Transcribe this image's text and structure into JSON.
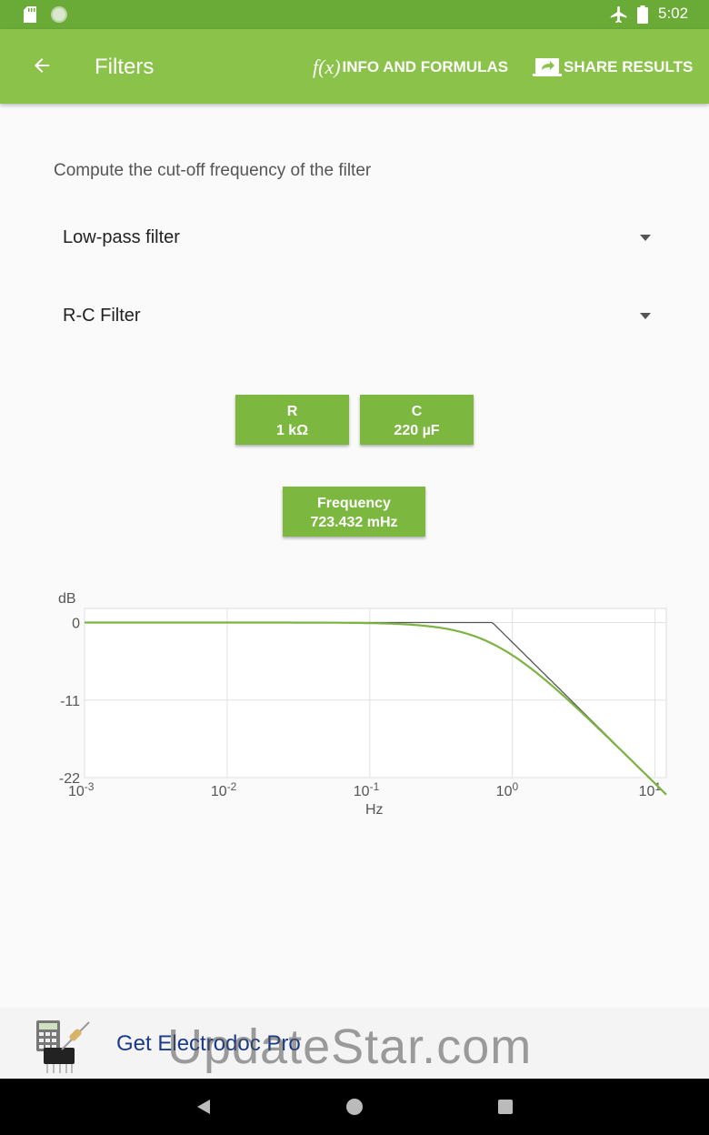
{
  "status_bar": {
    "time": "5:02"
  },
  "app_bar": {
    "title": "Filters",
    "info_icon": "f(x)",
    "info_label": "INFO AND FORMULAS",
    "share_label": "SHARE RESULTS"
  },
  "main": {
    "subtitle": "Compute the cut-off frequency of the filter",
    "filter_select": {
      "value": "Low-pass filter"
    },
    "type_select": {
      "value": "R-C Filter"
    },
    "params": {
      "r": {
        "label": "R",
        "value": "1 kΩ"
      },
      "c": {
        "label": "C",
        "value": "220 µF"
      },
      "frequency": {
        "label": "Frequency",
        "value": "723.432 mHz"
      }
    }
  },
  "chart_data": {
    "type": "line",
    "ylabel": "dB",
    "xlabel": "Hz",
    "x_scale": "log",
    "xlim": [
      0.001,
      12
    ],
    "ylim": [
      -22,
      2
    ],
    "y_ticks": [
      0,
      -11,
      -22
    ],
    "x_ticks": [
      "10-3",
      "10-2",
      "10-1",
      "100",
      "101"
    ],
    "x_tick_values": [
      0.001,
      0.01,
      0.1,
      1,
      10
    ],
    "cutoff_hz": 0.723432,
    "grid": true,
    "series": [
      {
        "kind": "asymptote",
        "color": "#555555"
      },
      {
        "kind": "response",
        "color": "#7cb342"
      }
    ]
  },
  "promo": {
    "text": "Get Electrodoc Pro",
    "watermark": "UpdateStar.com"
  }
}
